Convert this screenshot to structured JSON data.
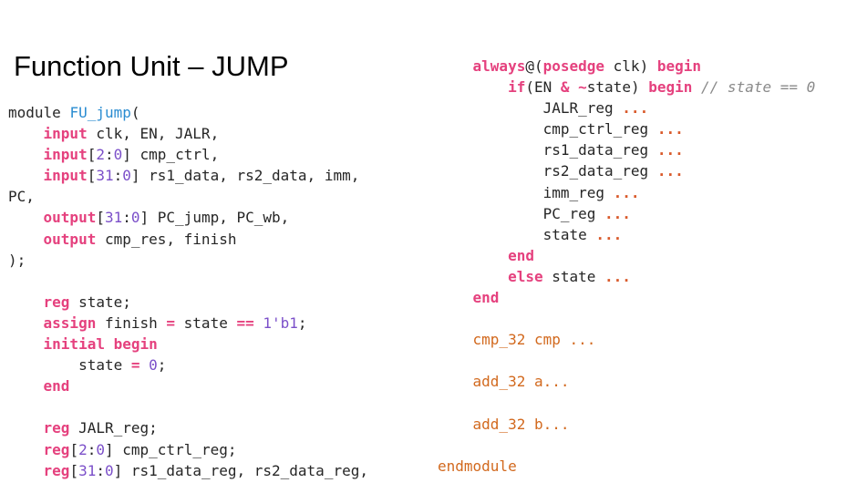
{
  "slide_title": "Function Unit – JUMP",
  "left_code_lines": [
    [
      {
        "t": "module ",
        "c": ""
      },
      {
        "t": "FU_jump",
        "c": "mod"
      },
      {
        "t": "(",
        "c": ""
      }
    ],
    [
      {
        "t": "    ",
        "c": ""
      },
      {
        "t": "input",
        "c": "kw"
      },
      {
        "t": " clk, EN, JALR,",
        "c": ""
      }
    ],
    [
      {
        "t": "    ",
        "c": ""
      },
      {
        "t": "input",
        "c": "kw"
      },
      {
        "t": "[",
        "c": ""
      },
      {
        "t": "2",
        "c": "num"
      },
      {
        "t": ":",
        "c": ""
      },
      {
        "t": "0",
        "c": "num"
      },
      {
        "t": "] cmp_ctrl,",
        "c": ""
      }
    ],
    [
      {
        "t": "    ",
        "c": ""
      },
      {
        "t": "input",
        "c": "kw"
      },
      {
        "t": "[",
        "c": ""
      },
      {
        "t": "31",
        "c": "num"
      },
      {
        "t": ":",
        "c": ""
      },
      {
        "t": "0",
        "c": "num"
      },
      {
        "t": "] rs1_data, rs2_data, imm,",
        "c": ""
      }
    ],
    [
      {
        "t": "PC,",
        "c": ""
      }
    ],
    [
      {
        "t": "    ",
        "c": ""
      },
      {
        "t": "output",
        "c": "kw"
      },
      {
        "t": "[",
        "c": ""
      },
      {
        "t": "31",
        "c": "num"
      },
      {
        "t": ":",
        "c": ""
      },
      {
        "t": "0",
        "c": "num"
      },
      {
        "t": "] PC_jump, PC_wb,",
        "c": ""
      }
    ],
    [
      {
        "t": "    ",
        "c": ""
      },
      {
        "t": "output",
        "c": "kw"
      },
      {
        "t": " cmp_res, finish",
        "c": ""
      }
    ],
    [
      {
        "t": ");",
        "c": ""
      }
    ],
    [
      {
        "t": "",
        "c": ""
      }
    ],
    [
      {
        "t": "    ",
        "c": ""
      },
      {
        "t": "reg",
        "c": "kw"
      },
      {
        "t": " state;",
        "c": ""
      }
    ],
    [
      {
        "t": "    ",
        "c": ""
      },
      {
        "t": "assign",
        "c": "kw"
      },
      {
        "t": " finish ",
        "c": ""
      },
      {
        "t": "=",
        "c": "kw"
      },
      {
        "t": " state ",
        "c": ""
      },
      {
        "t": "==",
        "c": "kw"
      },
      {
        "t": " ",
        "c": ""
      },
      {
        "t": "1'b1",
        "c": "num"
      },
      {
        "t": ";",
        "c": ""
      }
    ],
    [
      {
        "t": "    ",
        "c": ""
      },
      {
        "t": "initial begin",
        "c": "kw"
      }
    ],
    [
      {
        "t": "        state ",
        "c": ""
      },
      {
        "t": "=",
        "c": "kw"
      },
      {
        "t": " ",
        "c": ""
      },
      {
        "t": "0",
        "c": "num"
      },
      {
        "t": ";",
        "c": ""
      }
    ],
    [
      {
        "t": "    ",
        "c": ""
      },
      {
        "t": "end",
        "c": "kw"
      }
    ],
    [
      {
        "t": "",
        "c": ""
      }
    ],
    [
      {
        "t": "    ",
        "c": ""
      },
      {
        "t": "reg",
        "c": "kw"
      },
      {
        "t": " JALR_reg;",
        "c": ""
      }
    ],
    [
      {
        "t": "    ",
        "c": ""
      },
      {
        "t": "reg",
        "c": "kw"
      },
      {
        "t": "[",
        "c": ""
      },
      {
        "t": "2",
        "c": "num"
      },
      {
        "t": ":",
        "c": ""
      },
      {
        "t": "0",
        "c": "num"
      },
      {
        "t": "] cmp_ctrl_reg;",
        "c": ""
      }
    ],
    [
      {
        "t": "    ",
        "c": ""
      },
      {
        "t": "reg",
        "c": "kw"
      },
      {
        "t": "[",
        "c": ""
      },
      {
        "t": "31",
        "c": "num"
      },
      {
        "t": ":",
        "c": ""
      },
      {
        "t": "0",
        "c": "num"
      },
      {
        "t": "] rs1_data_reg, rs2_data_reg,",
        "c": ""
      }
    ]
  ],
  "right_code_lines": [
    [
      {
        "t": "    ",
        "c": ""
      },
      {
        "t": "always",
        "c": "kw"
      },
      {
        "t": "@(",
        "c": ""
      },
      {
        "t": "posedge",
        "c": "kw"
      },
      {
        "t": " clk) ",
        "c": ""
      },
      {
        "t": "begin",
        "c": "kw"
      }
    ],
    [
      {
        "t": "        ",
        "c": ""
      },
      {
        "t": "if",
        "c": "kw"
      },
      {
        "t": "(EN ",
        "c": ""
      },
      {
        "t": "&",
        "c": "kw"
      },
      {
        "t": " ",
        "c": ""
      },
      {
        "t": "~",
        "c": "kw"
      },
      {
        "t": "state) ",
        "c": ""
      },
      {
        "t": "begin",
        "c": "kw"
      },
      {
        "t": " ",
        "c": ""
      },
      {
        "t": "// state == 0",
        "c": "cm"
      }
    ],
    [
      {
        "t": "            JALR_reg ",
        "c": ""
      },
      {
        "t": "...",
        "c": "dots"
      }
    ],
    [
      {
        "t": "            cmp_ctrl_reg ",
        "c": ""
      },
      {
        "t": "...",
        "c": "dots"
      }
    ],
    [
      {
        "t": "            rs1_data_reg ",
        "c": ""
      },
      {
        "t": "...",
        "c": "dots"
      }
    ],
    [
      {
        "t": "            rs2_data_reg ",
        "c": ""
      },
      {
        "t": "...",
        "c": "dots"
      }
    ],
    [
      {
        "t": "            imm_reg ",
        "c": ""
      },
      {
        "t": "...",
        "c": "dots"
      }
    ],
    [
      {
        "t": "            PC_reg ",
        "c": ""
      },
      {
        "t": "...",
        "c": "dots"
      }
    ],
    [
      {
        "t": "            state ",
        "c": ""
      },
      {
        "t": "...",
        "c": "dots"
      }
    ],
    [
      {
        "t": "        ",
        "c": ""
      },
      {
        "t": "end",
        "c": "kw"
      }
    ],
    [
      {
        "t": "        ",
        "c": ""
      },
      {
        "t": "else",
        "c": "kw"
      },
      {
        "t": " state ",
        "c": ""
      },
      {
        "t": "...",
        "c": "dots"
      }
    ],
    [
      {
        "t": "    ",
        "c": ""
      },
      {
        "t": "end",
        "c": "kw"
      }
    ],
    [
      {
        "t": "",
        "c": ""
      }
    ],
    [
      {
        "t": "    ",
        "c": ""
      },
      {
        "t": "cmp_32 cmp ...",
        "c": "inst"
      }
    ],
    [
      {
        "t": "",
        "c": ""
      }
    ],
    [
      {
        "t": "    ",
        "c": ""
      },
      {
        "t": "add_32 a...",
        "c": "inst"
      }
    ],
    [
      {
        "t": "",
        "c": ""
      }
    ],
    [
      {
        "t": "    ",
        "c": ""
      },
      {
        "t": "add_32 b...",
        "c": "inst"
      }
    ],
    [
      {
        "t": "",
        "c": ""
      }
    ],
    [
      {
        "t": "endmodule",
        "c": "inst"
      }
    ]
  ]
}
